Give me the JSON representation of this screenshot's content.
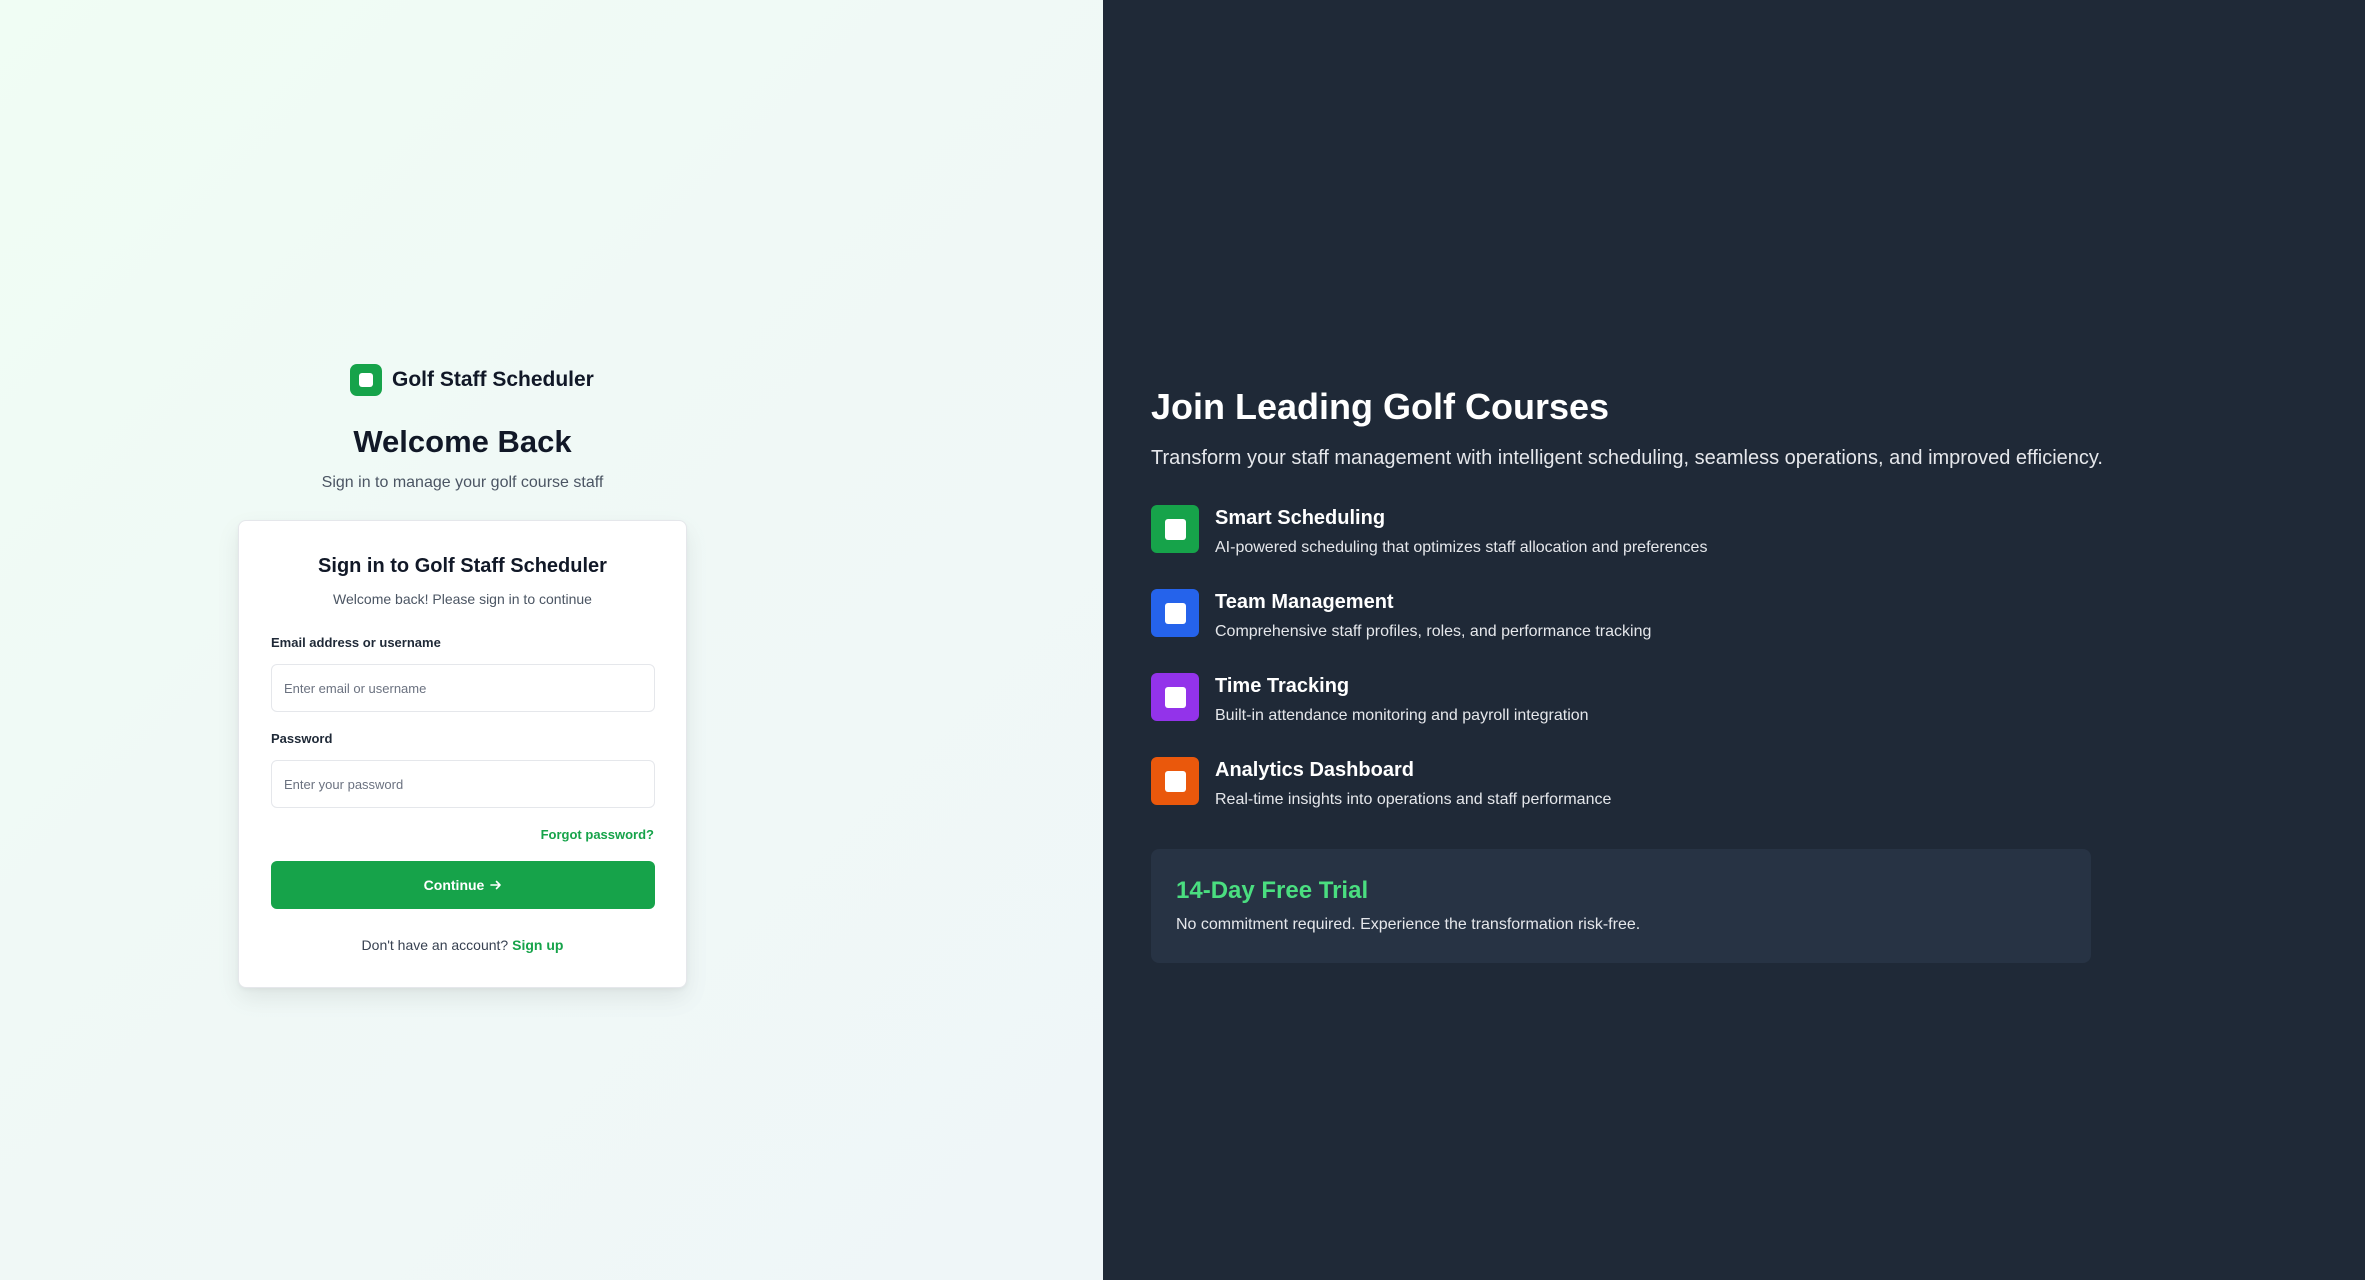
{
  "brand": {
    "name": "Golf Staff Scheduler",
    "icon": "square-logo-icon",
    "color": "#16a34a"
  },
  "welcome": {
    "title": "Welcome Back",
    "subtitle": "Sign in to manage your golf course staff"
  },
  "signin": {
    "title": "Sign in to Golf Staff Scheduler",
    "subtitle": "Welcome back! Please sign in to continue",
    "email_label": "Email address or username",
    "email_placeholder": "Enter email or username",
    "password_label": "Password",
    "password_placeholder": "Enter your password",
    "forgot_label": "Forgot password?",
    "continue_label": "Continue",
    "continue_icon": "arrow-right-icon",
    "no_account_text": "Don't have an account?",
    "signup_label": "Sign up"
  },
  "hero": {
    "title": "Join Leading Golf Courses",
    "subtitle": "Transform your staff management with intelligent scheduling, seamless operations, and improved efficiency."
  },
  "features": [
    {
      "title": "Smart Scheduling",
      "description": "AI-powered scheduling that optimizes staff allocation and preferences",
      "color": "#16a34a"
    },
    {
      "title": "Team Management",
      "description": "Comprehensive staff profiles, roles, and performance tracking",
      "color": "#2563eb"
    },
    {
      "title": "Time Tracking",
      "description": "Built-in attendance monitoring and payroll integration",
      "color": "#9333ea"
    },
    {
      "title": "Analytics Dashboard",
      "description": "Real-time insights into operations and staff performance",
      "color": "#ea580c"
    }
  ],
  "trial": {
    "title": "14-Day Free Trial",
    "subtitle": "No commitment required. Experience the transformation risk-free."
  },
  "colors": {
    "accent": "#16a34a",
    "dark_panel": "#1f2937",
    "trial_accent": "#4ade80"
  }
}
